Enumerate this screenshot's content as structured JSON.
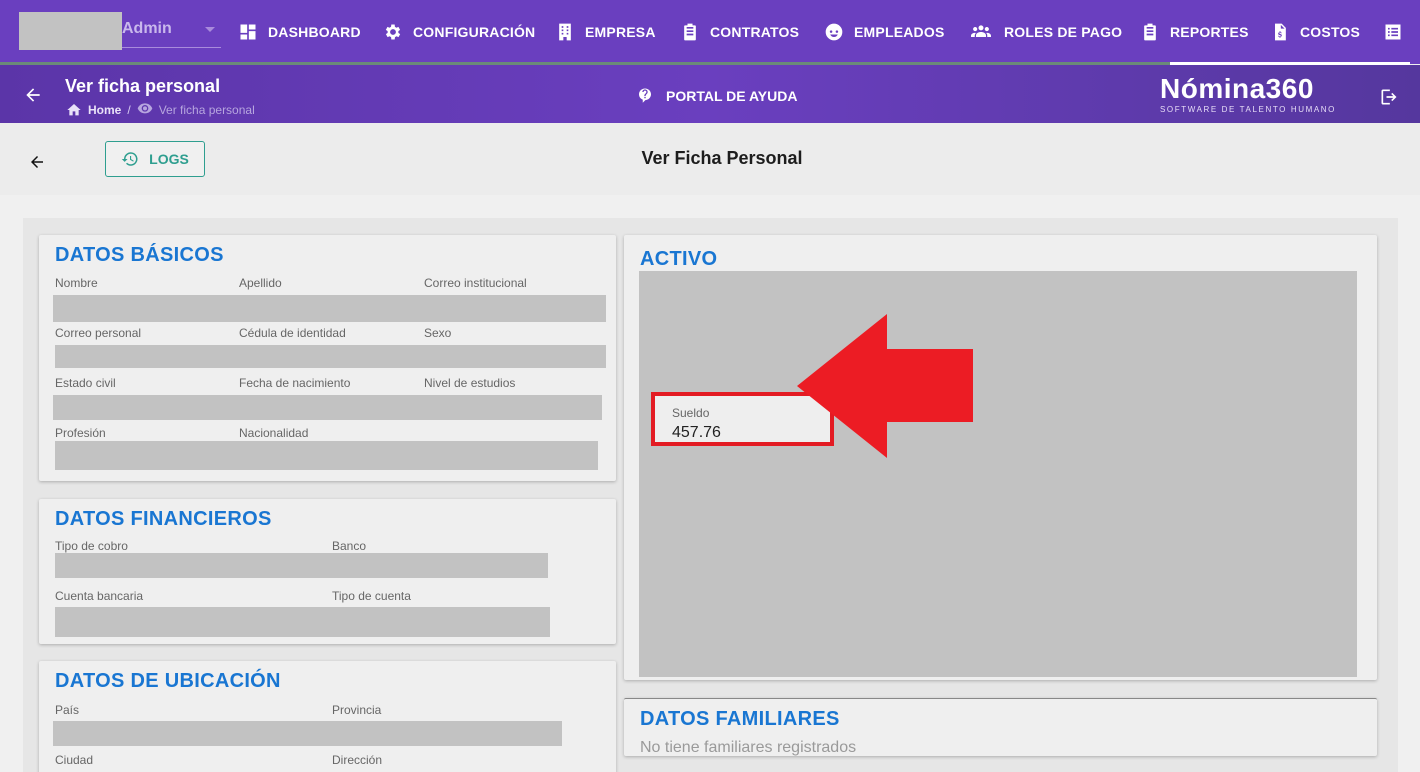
{
  "user": {
    "name": "Admin"
  },
  "nav": {
    "items": [
      {
        "label": "DASHBOARD",
        "icon": "dashboard-icon"
      },
      {
        "label": "CONFIGURACIÓN",
        "icon": "gear-icon"
      },
      {
        "label": "EMPRESA",
        "icon": "building-icon"
      },
      {
        "label": "CONTRATOS",
        "icon": "clipboard-icon"
      },
      {
        "label": "EMPLEADOS",
        "icon": "face-icon"
      },
      {
        "label": "ROLES DE PAGO",
        "icon": "group-icon"
      },
      {
        "label": "REPORTES",
        "icon": "clipboard-icon"
      },
      {
        "label": "COSTOS",
        "icon": "invoice-icon"
      }
    ]
  },
  "subheader": {
    "title": "Ver ficha personal",
    "breadcrumb_home": "Home",
    "breadcrumb_separator": "/",
    "breadcrumb_current": "Ver ficha personal",
    "help_label": "PORTAL DE AYUDA",
    "brand_name": "Nómina360",
    "brand_tagline": "SOFTWARE DE TALENTO HUMANO"
  },
  "toolbar": {
    "logs_label": "LOGS",
    "page_title": "Ver Ficha Personal"
  },
  "datos_basicos": {
    "title": "DATOS BÁSICOS",
    "labels": [
      "Nombre",
      "Apellido",
      "Correo institucional",
      "Correo personal",
      "Cédula de identidad",
      "Sexo",
      "Estado civil",
      "Fecha de nacimiento",
      "Nivel de estudios",
      "Profesión",
      "Nacionalidad"
    ]
  },
  "datos_financieros": {
    "title": "DATOS FINANCIEROS",
    "labels": [
      "Tipo de cobro",
      "Banco",
      "Cuenta bancaria",
      "Tipo de cuenta"
    ]
  },
  "datos_ubicacion": {
    "title": "DATOS DE UBICACIÓN",
    "labels": [
      "País",
      "Provincia",
      "Ciudad",
      "Dirección"
    ]
  },
  "activo": {
    "title": "ACTIVO",
    "sueldo_label": "Sueldo",
    "sueldo_value": "457.76"
  },
  "datos_familiares": {
    "title": "DATOS FAMILIARES",
    "empty_message": "No tiene familiares registrados"
  },
  "colors": {
    "nav_bg": "#6a3fbf",
    "accent_title": "#1976d2",
    "logs_teal": "#2e9e8f",
    "highlight_red": "#e31b23"
  }
}
